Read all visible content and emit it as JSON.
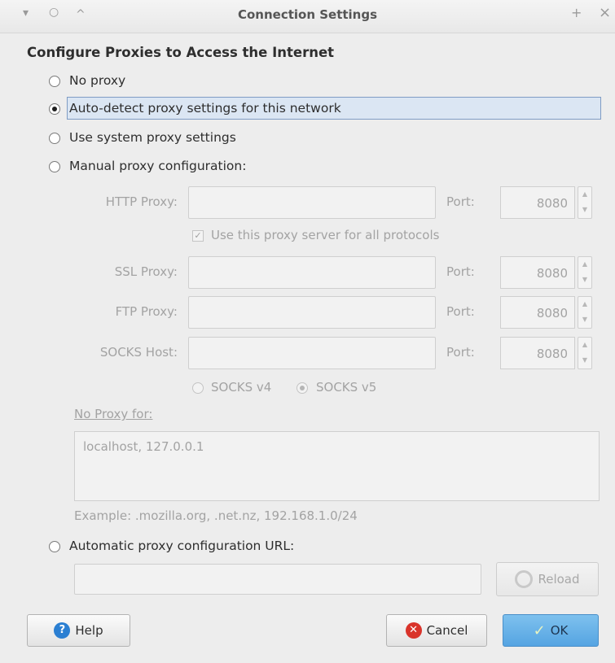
{
  "window": {
    "title": "Connection Settings",
    "controls": {
      "minimize": "▾",
      "maximize": "○",
      "shade": "^",
      "pin": "+",
      "close": "×"
    }
  },
  "heading": "Configure Proxies to Access the Internet",
  "proxy_options": {
    "no_proxy": "No proxy",
    "auto_detect": "Auto-detect proxy settings for this network",
    "system": "Use system proxy settings",
    "manual": "Manual proxy configuration:",
    "auto_url": "Automatic proxy configuration URL:",
    "selected": "auto_detect"
  },
  "manual": {
    "http_label": "HTTP Proxy:",
    "http_value": "",
    "port_label": "Port:",
    "http_port": "8080",
    "use_all_label": "Use this proxy server for all protocols",
    "use_all_checked": true,
    "ssl_label": "SSL Proxy:",
    "ssl_value": "",
    "ssl_port": "8080",
    "ftp_label": "FTP Proxy:",
    "ftp_value": "",
    "ftp_port": "8080",
    "socks_label": "SOCKS Host:",
    "socks_value": "",
    "socks_port": "8080",
    "socks_v4": "SOCKS v4",
    "socks_v5": "SOCKS v5",
    "socks_selected": "v5",
    "no_proxy_label": "No Proxy for:",
    "no_proxy_value": "localhost, 127.0.0.1",
    "example": "Example: .mozilla.org, .net.nz, 192.168.1.0/24"
  },
  "auto_url": {
    "value": "",
    "reload_label": "Reload"
  },
  "buttons": {
    "help": "Help",
    "cancel": "Cancel",
    "ok": "OK"
  },
  "colors": {
    "ok_button": "#5aa9e5",
    "cancel_icon": "#d9342b",
    "help_icon": "#2b7fd2",
    "focus_highlight": "#dbe6f3"
  }
}
